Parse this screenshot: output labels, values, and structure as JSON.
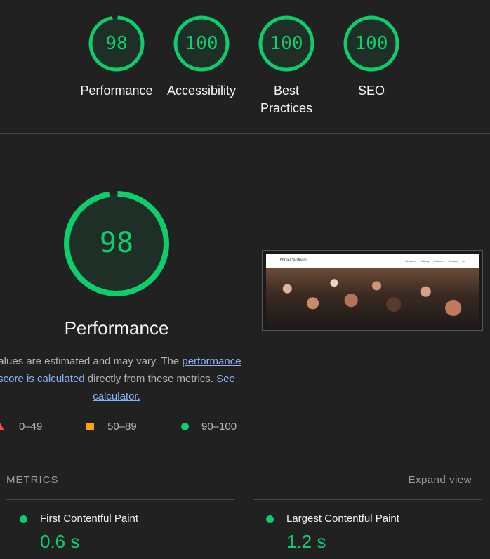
{
  "colors": {
    "pass": "#0cce6b",
    "average": "#ffa400",
    "fail": "#ff4e42",
    "link": "#8ab4f8",
    "background": "#212121"
  },
  "categories": [
    {
      "score": "98",
      "value": 0.98,
      "label": "Performance"
    },
    {
      "score": "100",
      "value": 1.0,
      "label": "Accessibility"
    },
    {
      "score": "100",
      "value": 1.0,
      "label": "Best Practices"
    },
    {
      "score": "100",
      "value": 1.0,
      "label": "SEO"
    }
  ],
  "performance": {
    "score": "98",
    "value": 0.98,
    "title": "Performance",
    "desc_part1": "Values are estimated and may vary. The ",
    "desc_link1": "performance score is calculated",
    "desc_part2": " directly from these metrics. ",
    "desc_link2": "See calculator."
  },
  "legend": [
    {
      "icon": "triangle-icon",
      "range": "0–49"
    },
    {
      "icon": "square-icon",
      "range": "50–89"
    },
    {
      "icon": "circle-icon",
      "range": "90–100"
    }
  ],
  "screenshot": {
    "brand": "Nina Carducci",
    "nav": [
      "Services",
      "Gallery",
      "Quiénes",
      "Contact",
      "Instagram"
    ]
  },
  "metrics": {
    "title": "METRICS",
    "expand_label": "Expand view",
    "items": [
      {
        "name": "First Contentful Paint",
        "value": "0.6 s"
      },
      {
        "name": "Largest Contentful Paint",
        "value": "1.2 s"
      }
    ]
  }
}
